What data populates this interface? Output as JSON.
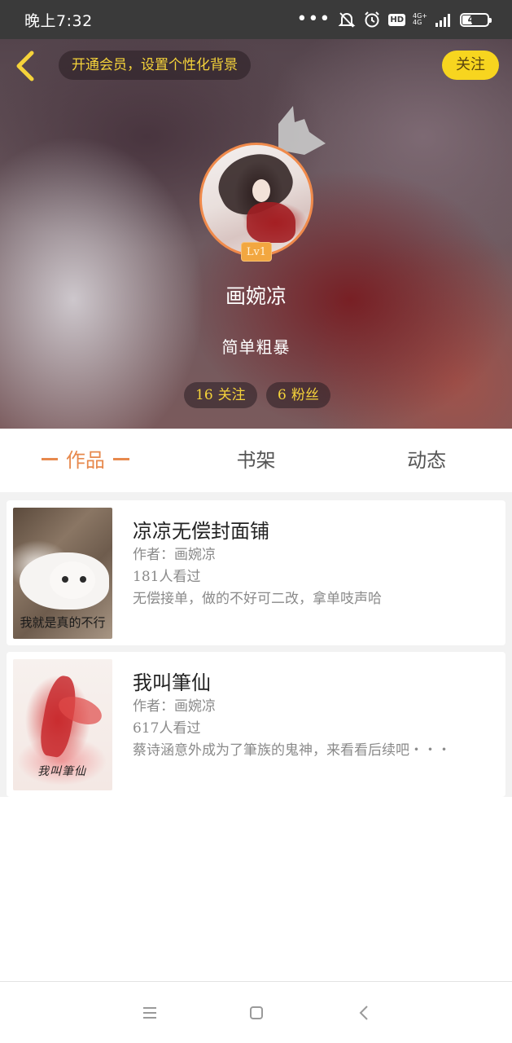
{
  "status_bar": {
    "time": "晚上7:32",
    "dots": "•••",
    "hd": "HD",
    "network_top": "4G+",
    "network_bottom": "4G",
    "battery": "44",
    "battery_level": 0.44
  },
  "header": {
    "vip_prompt": "开通会员，设置个性化背景",
    "follow_label": "关注"
  },
  "profile": {
    "level": "Lv1",
    "name": "画婉凉",
    "bio": "简单粗暴",
    "following_count": "16",
    "following_label": "关注",
    "followers_count": "6",
    "followers_label": "粉丝"
  },
  "tabs": [
    {
      "label": "作品",
      "active": true
    },
    {
      "label": "书架",
      "active": false
    },
    {
      "label": "动态",
      "active": false
    }
  ],
  "books": [
    {
      "title": "凉凉无偿封面铺",
      "author": "作者：画婉凉",
      "views": "181人看过",
      "description": "无偿接单，做的不好可二改，拿单吱声哈",
      "cover_caption": "我就是真的不行"
    },
    {
      "title": "我叫筆仙",
      "author": "作者：画婉凉",
      "views": "617人看过",
      "description": "蔡诗涵意外成为了筆族的鬼神，来看看后续吧・・・",
      "cover_caption": "我叫筆仙"
    }
  ],
  "colors": {
    "accent": "#e7894d",
    "follow_button": "#f7d51f",
    "pill_text": "#f5d33a"
  },
  "icons": {
    "back": "chevron-left-icon",
    "menu": "menu-icon",
    "home": "home-icon",
    "back_nav": "back-icon"
  }
}
